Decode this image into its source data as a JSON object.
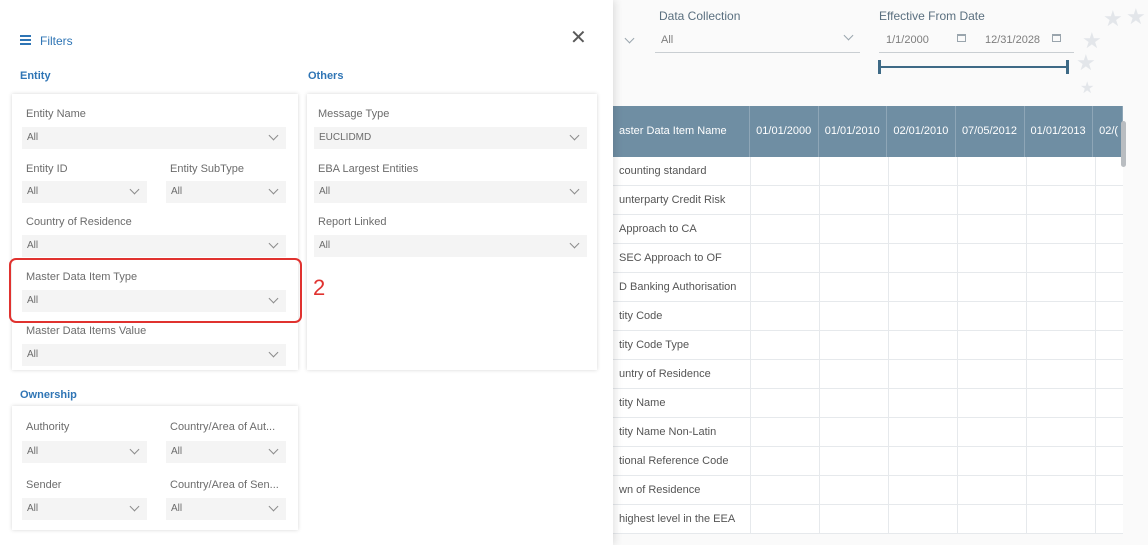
{
  "header": {
    "data_collection_label": "Data Collection",
    "data_collection_value": "All",
    "effective_from_label": "Effective From Date",
    "date_from": "1/1/2000",
    "date_to": "12/31/2028"
  },
  "table": {
    "headers": [
      "aster Data Item Name",
      "01/01/2000",
      "01/01/2010",
      "02/01/2010",
      "07/05/2012",
      "01/01/2013",
      "02/("
    ],
    "rows": [
      "counting standard",
      "unterparty Credit Risk",
      "Approach to CA",
      "SEC Approach to OF",
      "D Banking Authorisation",
      "tity Code",
      "tity Code Type",
      "untry of Residence",
      "tity Name",
      "tity Name Non-Latin",
      "tional Reference Code",
      "wn of Residence",
      "highest level in the EEA"
    ]
  },
  "filters": {
    "title": "Filters",
    "entity": {
      "section": "Entity",
      "entity_name_label": "Entity Name",
      "entity_name_value": "All",
      "entity_id_label": "Entity ID",
      "entity_id_value": "All",
      "entity_subtype_label": "Entity SubType",
      "entity_subtype_value": "All",
      "country_label": "Country of Residence",
      "country_value": "All",
      "mdi_type_label": "Master Data Item Type",
      "mdi_type_value": "All",
      "mdi_value_label": "Master Data Items Value",
      "mdi_value_value": "All"
    },
    "others": {
      "section": "Others",
      "message_type_label": "Message Type",
      "message_type_value": "EUCLIDMD",
      "eba_label": "EBA Largest Entities",
      "eba_value": "All",
      "report_label": "Report Linked",
      "report_value": "All"
    },
    "ownership": {
      "section": "Ownership",
      "authority_label": "Authority",
      "authority_value": "All",
      "country_auth_label": "Country/Area of Aut...",
      "country_auth_value": "All",
      "sender_label": "Sender",
      "sender_value": "All",
      "country_sen_label": "Country/Area of Sen...",
      "country_sen_value": "All"
    }
  },
  "annotation": {
    "number": "2",
    "color": "#e0322f"
  },
  "colors": {
    "accent": "#2f75b5",
    "table_header": "#6f8ea3"
  }
}
